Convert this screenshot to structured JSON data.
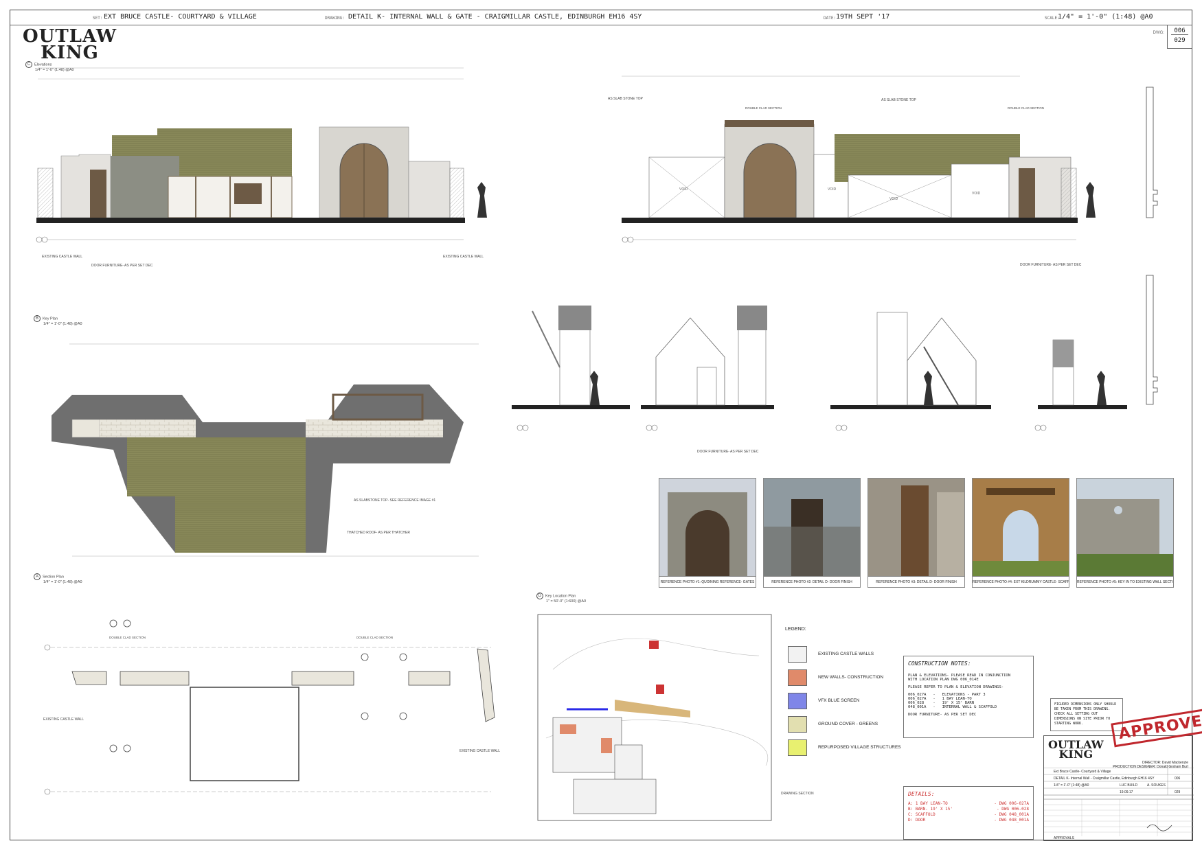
{
  "header": {
    "set_label": "SET:",
    "set_value": "EXT BRUCE CASTLE- COURTYARD & VILLAGE",
    "drawing_label": "DRAWING:",
    "drawing_value": "DETAIL K- INTERNAL WALL & GATE  - CRAIGMILLAR CASTLE, EDINBURGH  EH16 4SY",
    "date_label": "DATE:",
    "date_value": "19TH SEPT '17",
    "scale_label": "SCALE:",
    "scale_value": "1/4\" = 1'-0\" (1:48) @A0",
    "dwg_label": "DWG:",
    "dwg_top": "006",
    "dwg_bottom": "029"
  },
  "logo": {
    "line1": "OUTLAW",
    "line2": "KING"
  },
  "views": {
    "elevations": {
      "letter": "C",
      "title": "Elevations",
      "scale": "1/4\" = 1'-0\" (1:48) @A0"
    },
    "key_plan": {
      "letter": "B",
      "title": "Key Plan",
      "scale": "1/4\" = 1'-0\" (1:48) @A0"
    },
    "section_plan": {
      "letter": "A",
      "title": "Section Plan",
      "scale": "1/4\" = 1'-0\" (1:48) @A0"
    },
    "key_location": {
      "letter": "D",
      "title": "Key Location Plan",
      "scale": "1\" = 50'-0\" (1:600) @A0"
    }
  },
  "annotations": {
    "existing_castle_wall": "EXISTING CASTLE WALL",
    "door_furniture": "DOOR FURNITURE- AS PER SET DEC",
    "slab_stone_top": "AS SLAB STONE TOP",
    "double_clad": "DOUBLE CLAD SECTION",
    "thatched_roof": "THATCHED ROOF- AS PER THATCHER",
    "slabstone_top_ref": "AS SLABSTONE TOP- SEE REFERENCE IMAGE #1",
    "drawing_section": "DRAWING SECTION",
    "void": "VOID"
  },
  "photos": [
    {
      "caption": "REFERENCE PHOTO #1: QUOINING REFERENCE- GATES"
    },
    {
      "caption": "REFERENCE PHOTO #2: DETAIL D- DOOR FINISH"
    },
    {
      "caption": "REFERENCE PHOTO #3: DETAIL D- DOOR FINISH"
    },
    {
      "caption": "REFERENCE PHOTO #4: EXT KILDRUMMY CASTLE- SCAFFOLD"
    },
    {
      "caption": "REFERENCE PHOTO #5: KEY IN TO EXISTING WALL SECTION"
    }
  ],
  "legend": {
    "title": "LEGEND:",
    "items": [
      {
        "label": "EXISTING CASTLE WALLS",
        "color": "#f2f2f2"
      },
      {
        "label": "NEW WALLS- CONSTRUCTION",
        "color": "#e08a6a"
      },
      {
        "label": "VFX BLUE SCREEN",
        "color": "#7f86e8"
      },
      {
        "label": "GROUND COVER - GREENS",
        "color": "#e2dfb0"
      },
      {
        "label": "REPURPOSED VILLAGE STRUCTURES",
        "color": "#e8f070"
      }
    ]
  },
  "notes": {
    "title": "CONSTRUCTION NOTES:",
    "lines": [
      "PLAN & ELEVATIONS- PLEASE READ IN CONJUNCTION\nWITH LOCATION PLAN DWG 006_014E",
      "PLEASE REFER TO PLAN & ELEVATION DRAWINGS-",
      "006_027A   -   ELEVATIONS - PART 3\n006_027A   -   1 BAY LEAN-TO\n006_028    -   19' X 15' BARN\n048_001A   -   INTERNAL WALL & SCAFFOLD",
      "DOOR FURNITURE- AS PER SET DEC"
    ]
  },
  "details": {
    "title": "DETAILS:",
    "rows": [
      {
        "left": "A: 1 BAY LEAN-TO",
        "right": "- DWG 006-027A"
      },
      {
        "left": "B: BARN- 19' X 15'",
        "right": "- DWG 006-028"
      },
      {
        "left": "C: SCAFFOLD",
        "right": "- DWG 048_001A"
      },
      {
        "left": "D: DOOR",
        "right": "- DWG 048_001A"
      }
    ]
  },
  "figured": "FIGURED DIMENSIONS ONLY SHOULD BE TAKEN FROM THIS DRAWING. CHECK ALL SETTING OUT DIMENSIONS ON SITE PRIOR TO STARTING WORK.",
  "titleblock": {
    "director": "DIRECTOR: David Mackenzie",
    "designer": "PRODUCTION DESIGNER: Donald Graham Burt",
    "set": "Ext Bruce Castle- Courtyard & Village",
    "detail": "DETAIL K- Internal Wall - Craigmillar Castle, Edinburgh  EH16 4SY",
    "set_no": "006",
    "dwg_no": "029",
    "drawn_by": "LUC BUILD",
    "checked": "A. SOUKES",
    "date": "19.09.17",
    "scale": "1/4\" = 1'-0\" (1:48) @A0",
    "approvals": "APPROVALS"
  },
  "stamp": "APPROVED"
}
